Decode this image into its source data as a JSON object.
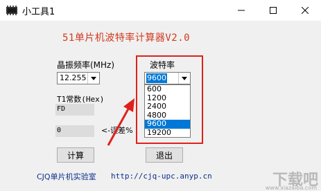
{
  "window": {
    "title": "小工具1",
    "minimize_icon": "minimize-icon",
    "maximize_icon": "maximize-icon",
    "close_icon": "close-icon"
  },
  "heading": "51单片机波特率计算器V2.0",
  "crystal": {
    "label": "晶振频率(MHz)",
    "value": "12.255"
  },
  "baud": {
    "label": "波特率",
    "value": "9600",
    "options": [
      "600",
      "1200",
      "2400",
      "4800",
      "9600",
      "19200"
    ],
    "selected": "9600"
  },
  "t1": {
    "label": "T1常数(Hex)",
    "value": "FD"
  },
  "error": {
    "value": "0",
    "label": "<-误差%"
  },
  "buttons": {
    "calculate": "计算",
    "exit": "退出"
  },
  "footer": {
    "brand": "CJQ单片机实验室",
    "url": "http://cjq-upc.anyp.cn"
  },
  "watermark": {
    "text": "下载吧",
    "sub": "www.xiazaiba.com"
  },
  "colors": {
    "heading": "#d23a20",
    "highlight_box": "#e0201b",
    "selection": "#0078d7",
    "link": "#0c2f8c"
  }
}
